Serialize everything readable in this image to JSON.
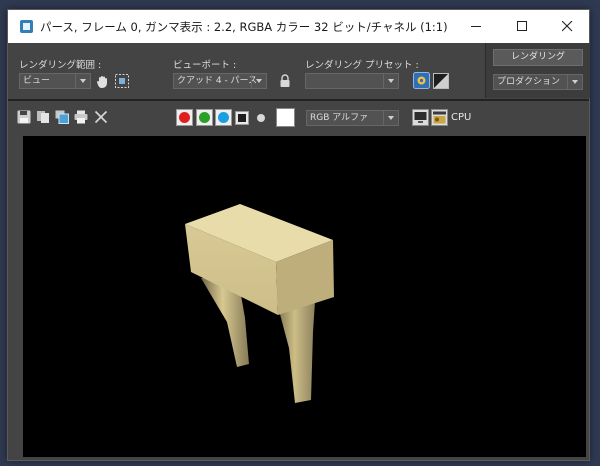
{
  "window": {
    "title": "パース, フレーム 0, ガンマ表示 : 2.2, RGBA カラー 32 ビット/チャネル (1:1)"
  },
  "settings": {
    "render_area_label": "レンダリング範囲 :",
    "render_area_value": "ビュー",
    "viewport_label": "ビューポート :",
    "viewport_value": "クアッド 4 - パース",
    "preset_label": "レンダリング プリセット :",
    "preset_value": "",
    "render_button": "レンダリング",
    "production_value": "プロダクション"
  },
  "toolbar": {
    "channel_display_value": "RGB アルファ",
    "renderer_label": "CPU"
  },
  "colors": {
    "red_channel": "#e02020",
    "green_channel": "#2aa02a",
    "blue_channel": "#1b9fe0",
    "object_fill": "#d8c891"
  }
}
